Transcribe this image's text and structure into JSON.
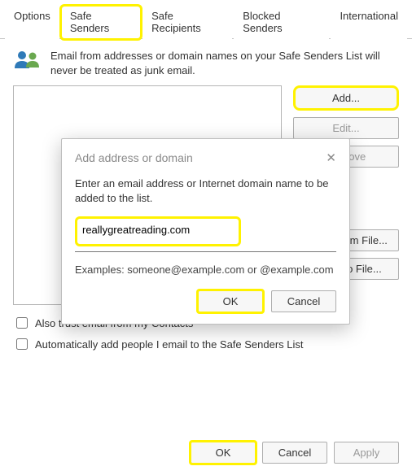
{
  "tabs": {
    "options": "Options",
    "safe_senders": "Safe Senders",
    "safe_recipients": "Safe Recipients",
    "blocked_senders": "Blocked Senders",
    "international": "International"
  },
  "description": "Email from addresses or domain names on your Safe Senders List will never be treated as junk email.",
  "buttons": {
    "add": "Add...",
    "edit": "Edit...",
    "remove": "Remove",
    "import": "Import from File...",
    "export": "Export to File..."
  },
  "checkboxes": {
    "trust_contacts": "Also trust email from my Contacts",
    "auto_add": "Automatically add people I email to the Safe Senders List"
  },
  "footer": {
    "ok": "OK",
    "cancel": "Cancel",
    "apply": "Apply"
  },
  "dialog": {
    "title": "Add address or domain",
    "message": "Enter an email address or Internet domain name to be added to the list.",
    "input_value": "reallygreatreading.com",
    "examples": "Examples: someone@example.com or @example.com",
    "ok": "OK",
    "cancel": "Cancel"
  }
}
